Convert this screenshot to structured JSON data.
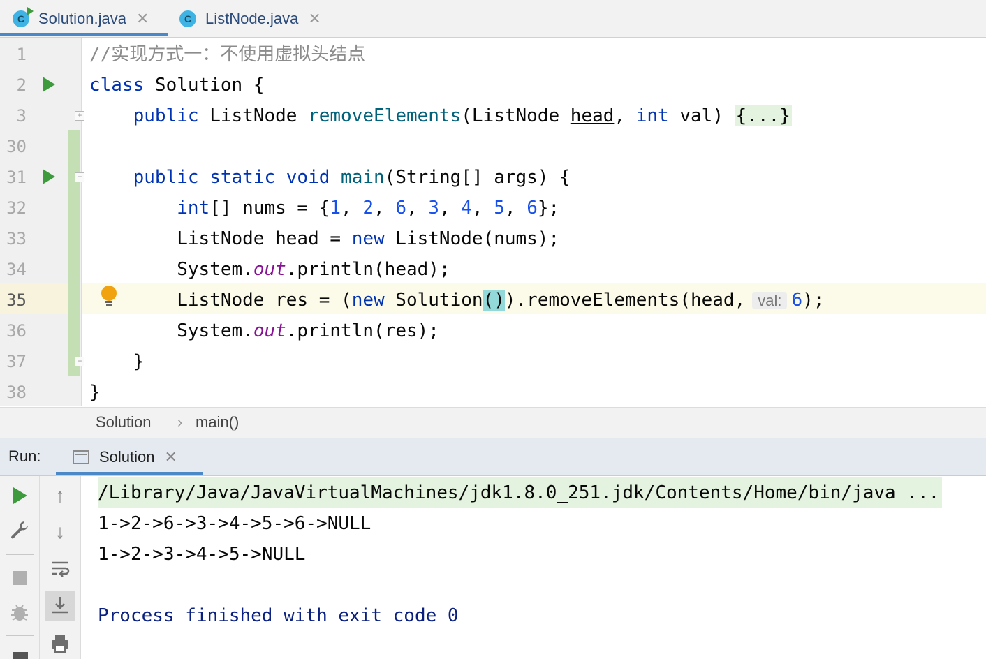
{
  "tabs": [
    {
      "label": "Solution.java",
      "icon": "java-class-icon",
      "active": true
    },
    {
      "label": "ListNode.java",
      "icon": "java-class-icon",
      "active": false
    }
  ],
  "tab_icon_letter": "C",
  "close_glyph": "✕",
  "editor": {
    "line_numbers": [
      "1",
      "2",
      "3",
      "30",
      "31",
      "32",
      "33",
      "34",
      "35",
      "36",
      "37",
      "38"
    ],
    "current_line": "35",
    "code": {
      "l1": "//实现方式一：不使用虚拟头结点",
      "l2": {
        "kw": "class",
        "rest": " Solution {"
      },
      "l3": {
        "kw1": "public",
        "type": " ListNode ",
        "fn": "removeElements",
        "p1": "(ListNode ",
        "head": "head",
        "p2": ", ",
        "kw2": "int",
        "p3": " val) ",
        "folded": "{...}"
      },
      "l31": {
        "kw": "public static void",
        "sp": " ",
        "fn": "main",
        "rest": "(String[] args) {"
      },
      "l32": {
        "kw": "int",
        "p1": "[] nums = {",
        "n1": "1",
        "n2": "2",
        "n3": "6",
        "n4": "3",
        "n5": "4",
        "n6": "5",
        "n7": "6",
        "end": "};",
        "comma": ", "
      },
      "l33": {
        "p1": "ListNode head = ",
        "kw": "new",
        "p2": " ListNode(nums);"
      },
      "l34": {
        "p1": "System.",
        "fld": "out",
        "p2": ".println(head);"
      },
      "l35": {
        "p1": "ListNode res = (",
        "kw": "new",
        "p2": " Solution",
        "paren": "()",
        "p3": ").removeElements(head,",
        "hint": "val:",
        "num": "6",
        "end": ");"
      },
      "l36": {
        "p1": "System.",
        "fld": "out",
        "p2": ".println(res);"
      },
      "l37": "}",
      "l38": "}"
    }
  },
  "breadcrumb": {
    "items": [
      "Solution",
      "main()"
    ],
    "separator": "›"
  },
  "run": {
    "label": "Run:",
    "tab": "Solution",
    "output": [
      "/Library/Java/JavaVirtualMachines/jdk1.8.0_251.jdk/Contents/Home/bin/java ...",
      "1->2->6->3->4->5->6->NULL",
      "1->2->3->4->5->NULL",
      "",
      "Process finished with exit code 0"
    ]
  },
  "toolbar_icons": {
    "col1": [
      "rerun-icon",
      "settings-wrench-icon",
      "stop-icon",
      "debug-bug-icon"
    ],
    "col2": [
      "up-arrow-icon",
      "down-arrow-icon",
      "soft-wrap-icon",
      "scroll-to-end-icon",
      "print-icon"
    ]
  },
  "colors": {
    "keyword": "#0033b3",
    "number": "#1750eb",
    "function": "#00627a",
    "field": "#871094",
    "comment": "#8c8c8c",
    "run_green": "#3d9b3d",
    "accent": "#4a88c7"
  }
}
